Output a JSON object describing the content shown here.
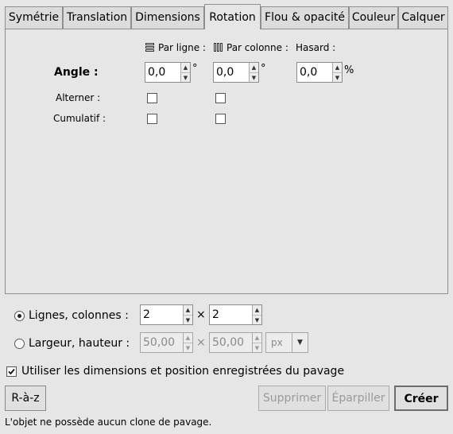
{
  "tabs": [
    {
      "label": "Symétrie"
    },
    {
      "label": "Translation"
    },
    {
      "label": "Dimensions"
    },
    {
      "label": "Rotation"
    },
    {
      "label": "Flou & opacité"
    },
    {
      "label": "Couleur"
    },
    {
      "label": "Calquer"
    }
  ],
  "active_tab": "Rotation",
  "rotation": {
    "col_headers": {
      "per_row": "Par ligne :",
      "per_col": "Par colonne :",
      "random": "Hasard :"
    },
    "angle_label": "Angle :",
    "angle_per_row": "0,0",
    "angle_per_col": "0,0",
    "angle_random": "0,0",
    "unit_degree": "°",
    "unit_percent": "%",
    "alternate_label": "Alterner :",
    "cumulative_label": "Cumulatif :"
  },
  "layout_options": {
    "rows_cols_label": "Lignes, colonnes :",
    "rows_value": "2",
    "cols_value": "2",
    "times_symbol": "×",
    "width_height_label": "Largeur, hauteur :",
    "width_value": "50,00",
    "height_value": "50,00",
    "unit_value": "px",
    "use_saved_label": "Utiliser les dimensions et position enregistrées du pavage"
  },
  "buttons": {
    "reset": "R-à-z",
    "remove": "Supprimer",
    "scatter": "Éparpiller",
    "create": "Créer"
  },
  "status": "L'objet ne possède aucun clone de pavage."
}
